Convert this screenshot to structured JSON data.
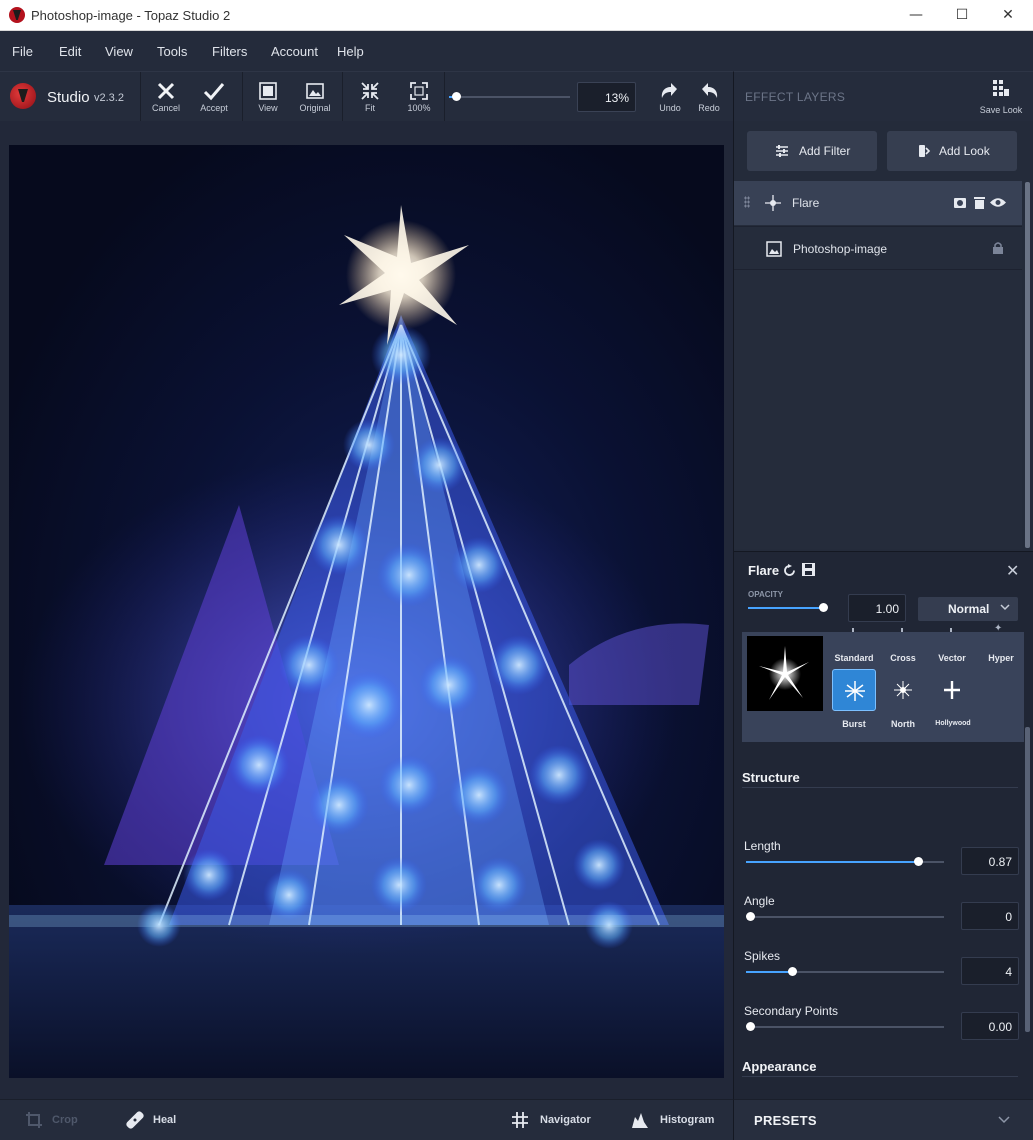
{
  "window": {
    "title": "Photoshop-image - Topaz Studio 2",
    "minimize_icon": "minimize-icon",
    "maximize_icon": "maximize-icon",
    "close_icon": "close-icon"
  },
  "menu": {
    "items": [
      {
        "label": "File"
      },
      {
        "label": "Edit"
      },
      {
        "label": "View"
      },
      {
        "label": "Tools"
      },
      {
        "label": "Filters"
      },
      {
        "label": "Account"
      },
      {
        "label": "Help"
      }
    ]
  },
  "toolbar": {
    "app_name": "Studio",
    "version": "v2.3.2",
    "cancel_label": "Cancel",
    "accept_label": "Accept",
    "view_label": "View",
    "original_label": "Original",
    "fit_label": "Fit",
    "hundred_label": "100%",
    "zoom_value": "13%",
    "zoom_fraction": 0.06,
    "undo_label": "Undo",
    "redo_label": "Redo"
  },
  "effect_layers": {
    "header": "EFFECT LAYERS",
    "save_look_label": "Save Look",
    "add_filter_label": "Add Filter",
    "add_look_label": "Add Look",
    "layers": [
      {
        "name": "Flare",
        "icon": "flare-icon",
        "selected": true
      },
      {
        "name": "Photoshop-image",
        "icon": "image-icon",
        "locked": true
      }
    ]
  },
  "filter_panel": {
    "title": "Flare",
    "opacity_label": "OPACITY",
    "opacity_value": "1.00",
    "opacity_fraction": 1.0,
    "blend_mode": "Normal",
    "styles": [
      {
        "label": "Standard",
        "selected": false
      },
      {
        "label": "Cross",
        "selected": false
      },
      {
        "label": "Vector",
        "selected": false
      },
      {
        "label": "Hyper",
        "selected": false
      },
      {
        "label": "Burst",
        "selected": true
      },
      {
        "label": "North",
        "selected": false
      },
      {
        "label": "Hollywood",
        "selected": false
      }
    ],
    "structure_title": "Structure",
    "params": [
      {
        "label": "Length",
        "value": "0.87",
        "fraction": 0.87
      },
      {
        "label": "Angle",
        "value": "0",
        "fraction": 0.0
      },
      {
        "label": "Spikes",
        "value": "4",
        "fraction": 0.23
      },
      {
        "label": "Secondary Points",
        "value": "0.00",
        "fraction": 0.0
      }
    ],
    "appearance_title": "Appearance"
  },
  "bottom": {
    "crop_label": "Crop",
    "heal_label": "Heal",
    "navigator_label": "Navigator",
    "histogram_label": "Histogram",
    "presets_label": "PRESETS"
  },
  "colors": {
    "accent": "#47a3ff",
    "panel_bg": "#242b3a",
    "selected_style": "#2f86d6"
  }
}
